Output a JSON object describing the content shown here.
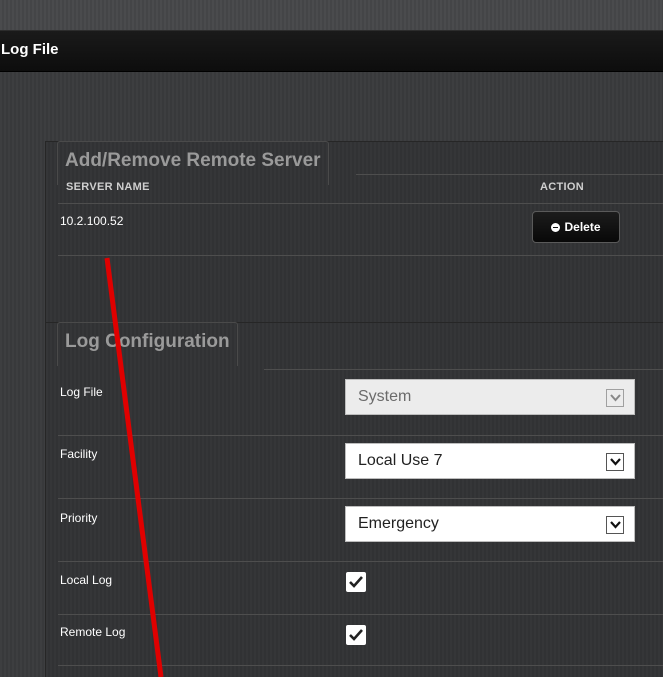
{
  "window": {
    "title": "Log File"
  },
  "remote_servers": {
    "legend": "Add/Remove Remote Server",
    "columns": {
      "server_name": "SERVER NAME",
      "action": "ACTION"
    },
    "rows": [
      {
        "server_name": "10.2.100.52",
        "action_label": "Delete",
        "action_icon": "minus-circle-icon"
      }
    ]
  },
  "log_config": {
    "legend": "Log Configuration",
    "log_file": {
      "label": "Log File",
      "value": "System",
      "disabled": true
    },
    "facility": {
      "label": "Facility",
      "value": "Local Use 7"
    },
    "priority": {
      "label": "Priority",
      "value": "Emergency"
    },
    "local_log": {
      "label": "Local Log",
      "checked": true
    },
    "remote_log": {
      "label": "Remote Log",
      "checked": true
    }
  },
  "colors": {
    "title_bar": "#111111",
    "background": "#3a3b3d",
    "annotation": "#e00000"
  }
}
